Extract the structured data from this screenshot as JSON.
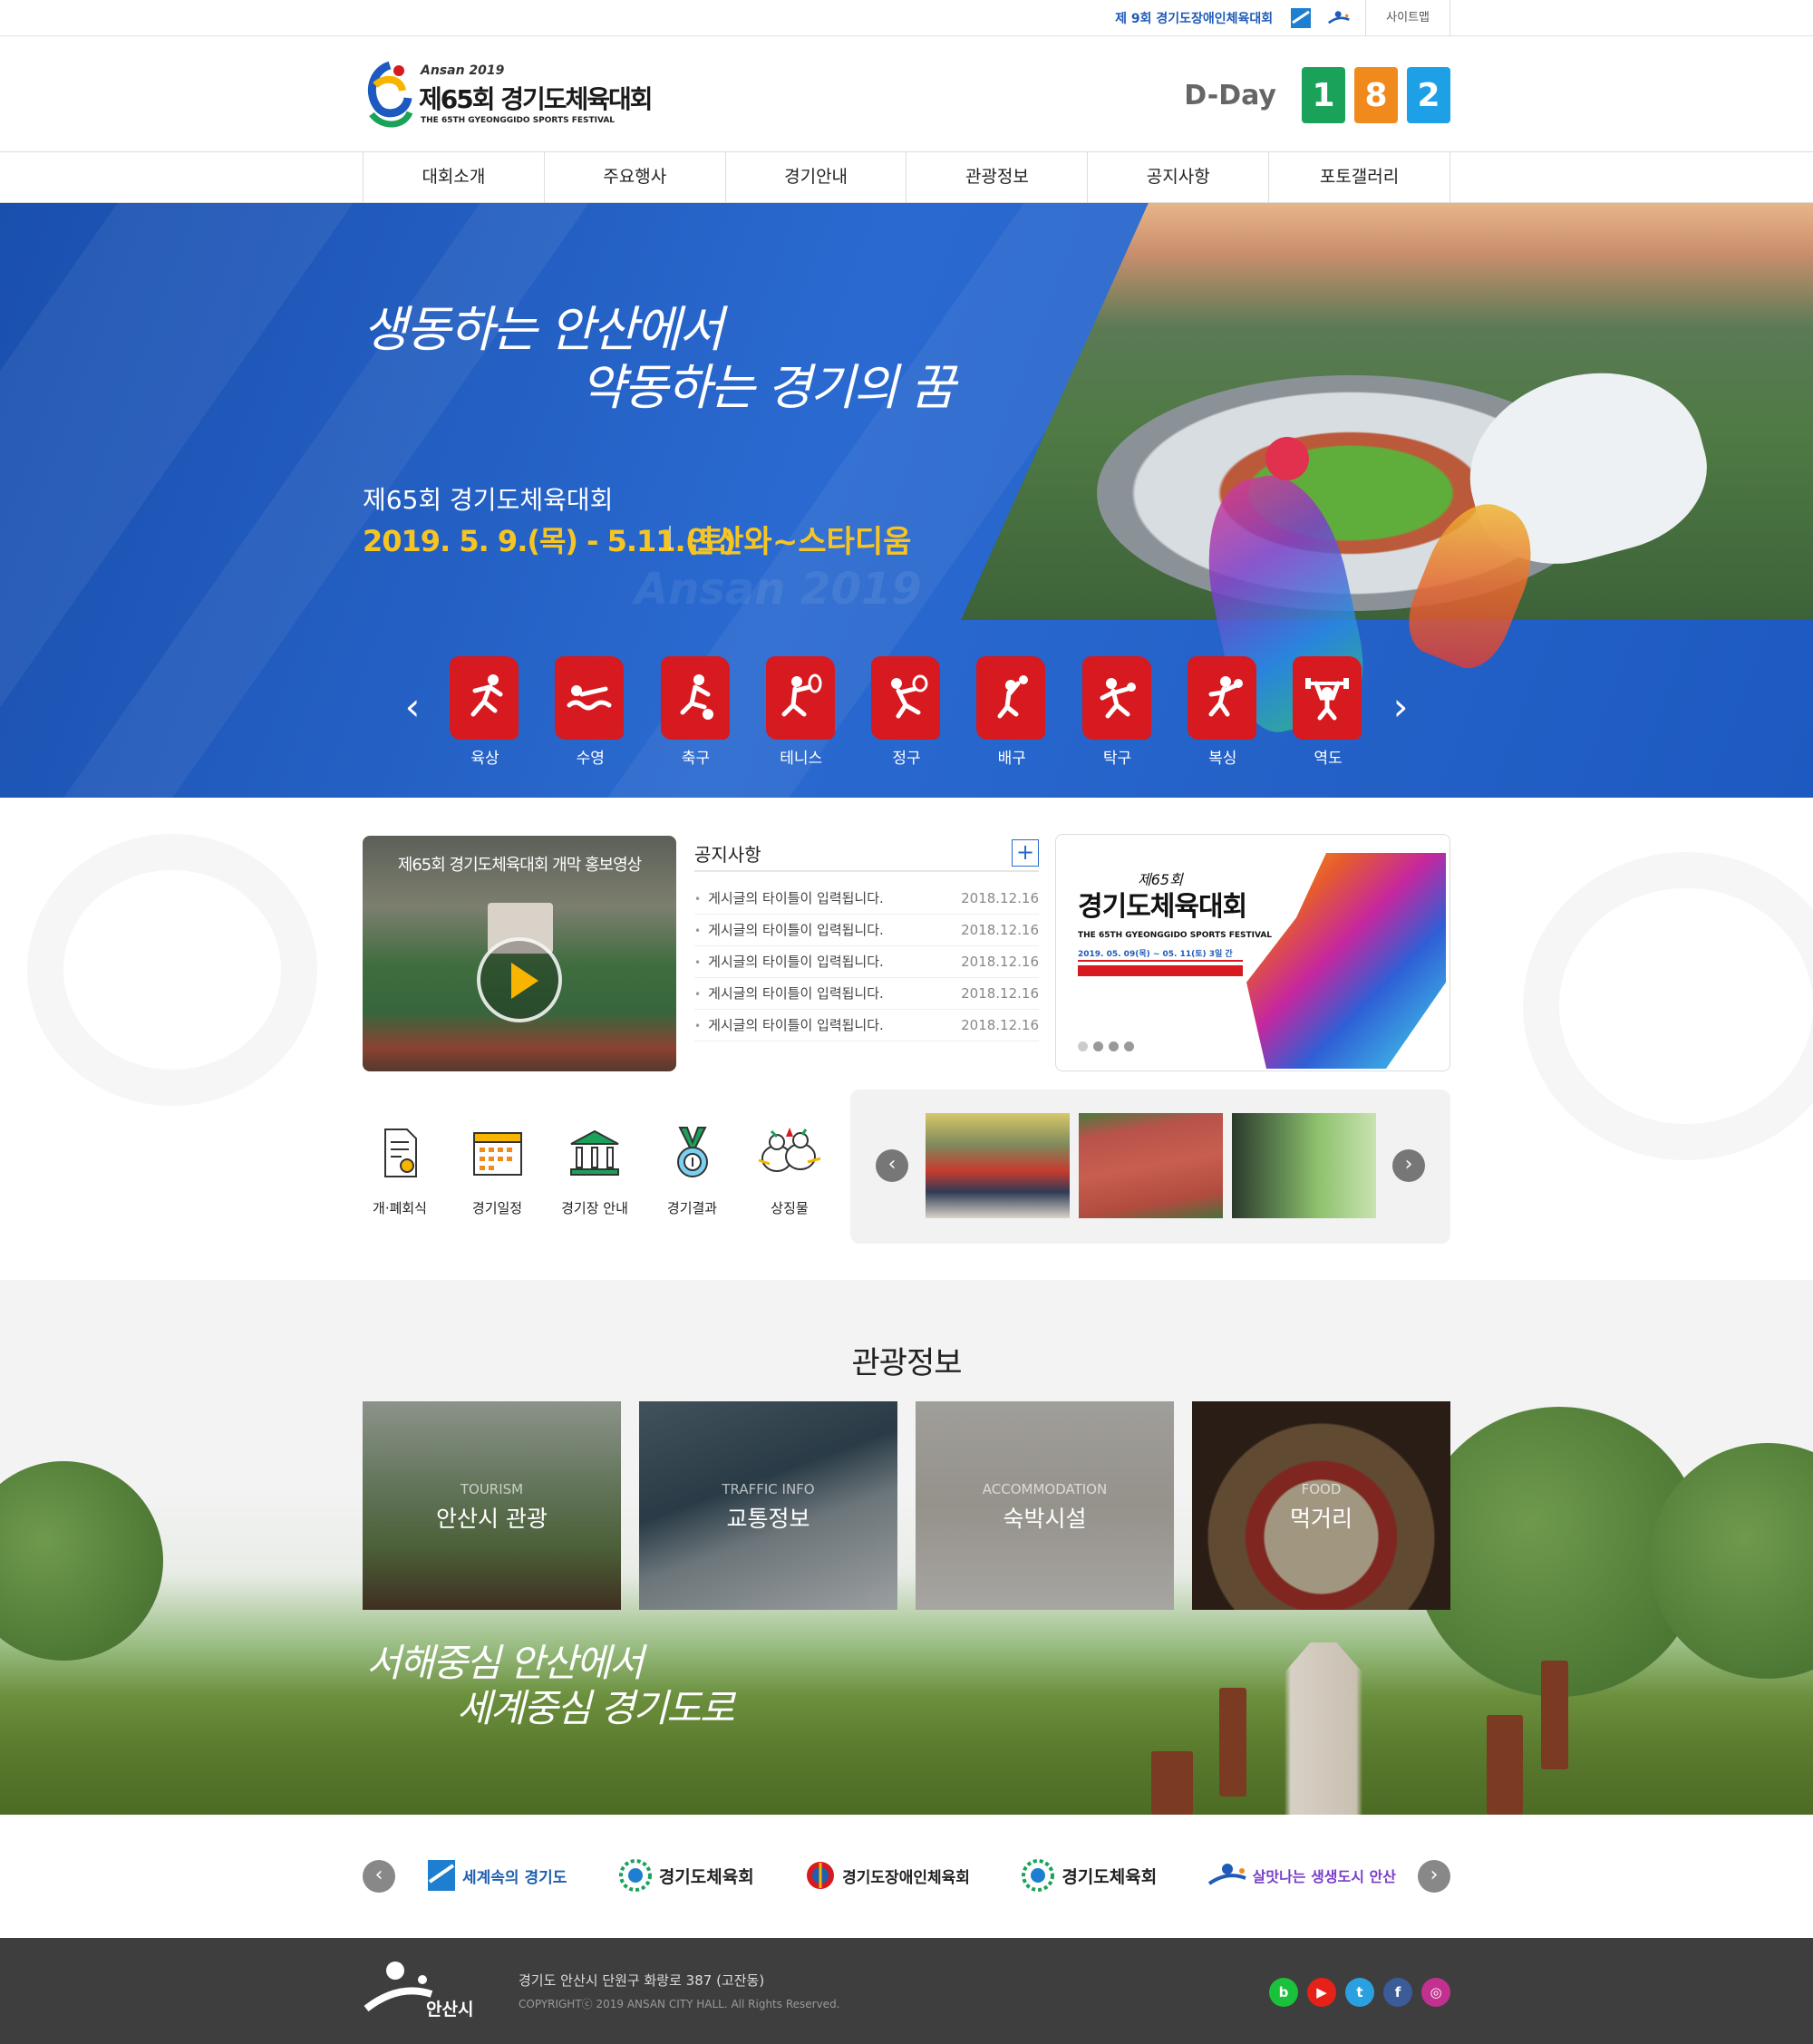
{
  "util": {
    "event_link": "제 9회 경기도장애인체육대회",
    "sitemap": "사이트맵"
  },
  "header": {
    "logo_top": "Ansan 2019",
    "logo_main": "제65회 경기도체육대회",
    "logo_sub": "THE 65TH GYEONGGIDO SPORTS FESTIVAL",
    "dday_label": "D-Day",
    "dday_digits": [
      "1",
      "8",
      "2"
    ],
    "dday_colors": [
      "#1aa25b",
      "#f08a1d",
      "#1ea0e6"
    ]
  },
  "nav": {
    "items": [
      "대회소개",
      "주요행사",
      "경기안내",
      "관광정보",
      "공지사항",
      "포토갤러리"
    ]
  },
  "hero": {
    "slogan_line1": "생동하는 안산에서",
    "slogan_line2": "약동하는 경기의 꿈",
    "title": "제65회 경기도체육대회",
    "dates": "2019. 5. 9.(목) - 5.11.(토)",
    "venue": "안산와~스타디움",
    "watermark": "Ansan 2019"
  },
  "sports": {
    "prev": "‹",
    "next": "›",
    "items": [
      "육상",
      "수영",
      "축구",
      "테니스",
      "정구",
      "배구",
      "탁구",
      "복싱",
      "역도"
    ]
  },
  "video": {
    "title": "제65회 경기도체육대회 개막 홍보영상"
  },
  "notice": {
    "title": "공지사항",
    "more": "+",
    "items": [
      {
        "title": "게시글의 타이틀이 입력됩니다.",
        "date": "2018.12.16"
      },
      {
        "title": "게시글의 타이틀이 입력됩니다.",
        "date": "2018.12.16"
      },
      {
        "title": "게시글의 타이틀이 입력됩니다.",
        "date": "2018.12.16"
      },
      {
        "title": "게시글의 타이틀이 입력됩니다.",
        "date": "2018.12.16"
      },
      {
        "title": "게시글의 타이틀이 입력됩니다.",
        "date": "2018.12.16"
      }
    ]
  },
  "poster": {
    "num": "제65회",
    "title": "경기도체육대회",
    "sub": "THE 65TH GYEONGGIDO SPORTS FESTIVAL",
    "date": "2019. 05. 09(목) ~ 05. 11(토) 3일 간"
  },
  "quick": {
    "items": [
      "개·폐회식",
      "경기일정",
      "경기장 안내",
      "경기결과",
      "상징물"
    ]
  },
  "gallery": {
    "prev": "‹",
    "next": "›"
  },
  "tourism": {
    "title": "관광정보",
    "cards": [
      {
        "en": "TOURISM",
        "ko": "안산시 관광"
      },
      {
        "en": "TRAFFIC INFO",
        "ko": "교통정보"
      },
      {
        "en": "ACCOMMODATION",
        "ko": "숙박시설"
      },
      {
        "en": "FOOD",
        "ko": "먹거리"
      }
    ],
    "slogan_line1": "서해중심 안산에서",
    "slogan_line2": "세계중심 경기도로"
  },
  "partners": {
    "prev": "‹",
    "next": "›",
    "items": [
      "세계속의 경기도",
      "경기도체육회",
      "경기도장애인체육회",
      "경기도체육회",
      "살맛나는 생생도시 안산"
    ]
  },
  "footer": {
    "logo_text": "안산시",
    "address": "경기도 안산시 단원구 화랑로 387 (고잔동)",
    "copyright": "COPYRIGHTⓒ 2019 ANSAN CITY HALL. All Rights Reserved.",
    "sns": [
      "b",
      "▶",
      "t",
      "f",
      "◎"
    ],
    "sns_colors": [
      "#19c23a",
      "#e62117",
      "#2ba0e0",
      "#3b5b99",
      "#c2318f"
    ]
  }
}
